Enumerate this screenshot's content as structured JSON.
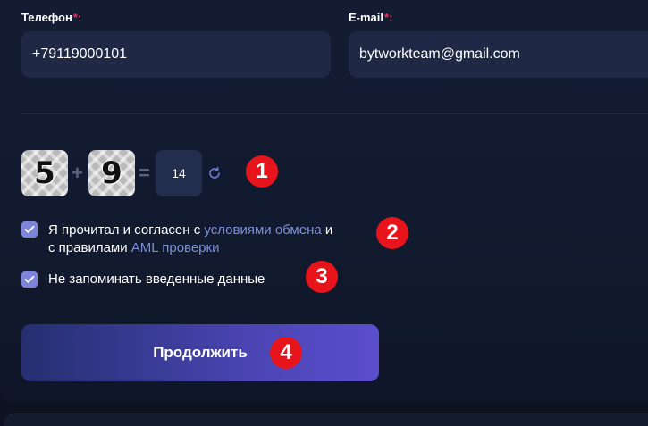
{
  "form": {
    "phone_label": "Телефон",
    "email_label": "E-mail",
    "required_mark": "*:",
    "phone_value": "+79119000101",
    "email_value": "bytworkteam@gmail.com"
  },
  "captcha": {
    "first": "5",
    "plus": "+",
    "second": "9",
    "equals": "=",
    "answer": "14",
    "refresh_icon": "refresh-icon"
  },
  "agreement": {
    "text_1": "Я прочитал и согласен с ",
    "link_terms": "условиями обмена",
    "text_2": " и",
    "text_3": "с правилами ",
    "link_aml": "AML проверки",
    "checked": true
  },
  "remember": {
    "text": "Не запоминать введенные данные",
    "checked": true
  },
  "submit_label": "Продолжить",
  "markers": [
    "1",
    "2",
    "3",
    "4"
  ],
  "colors": {
    "background": "#0d1120",
    "input_bg": "#1f2946",
    "accent": "#7d84d9",
    "link": "#7d8fd8",
    "required": "#e0355a",
    "marker": "#e8141b",
    "button_start": "#252f70",
    "button_end": "#5a4ecd"
  }
}
